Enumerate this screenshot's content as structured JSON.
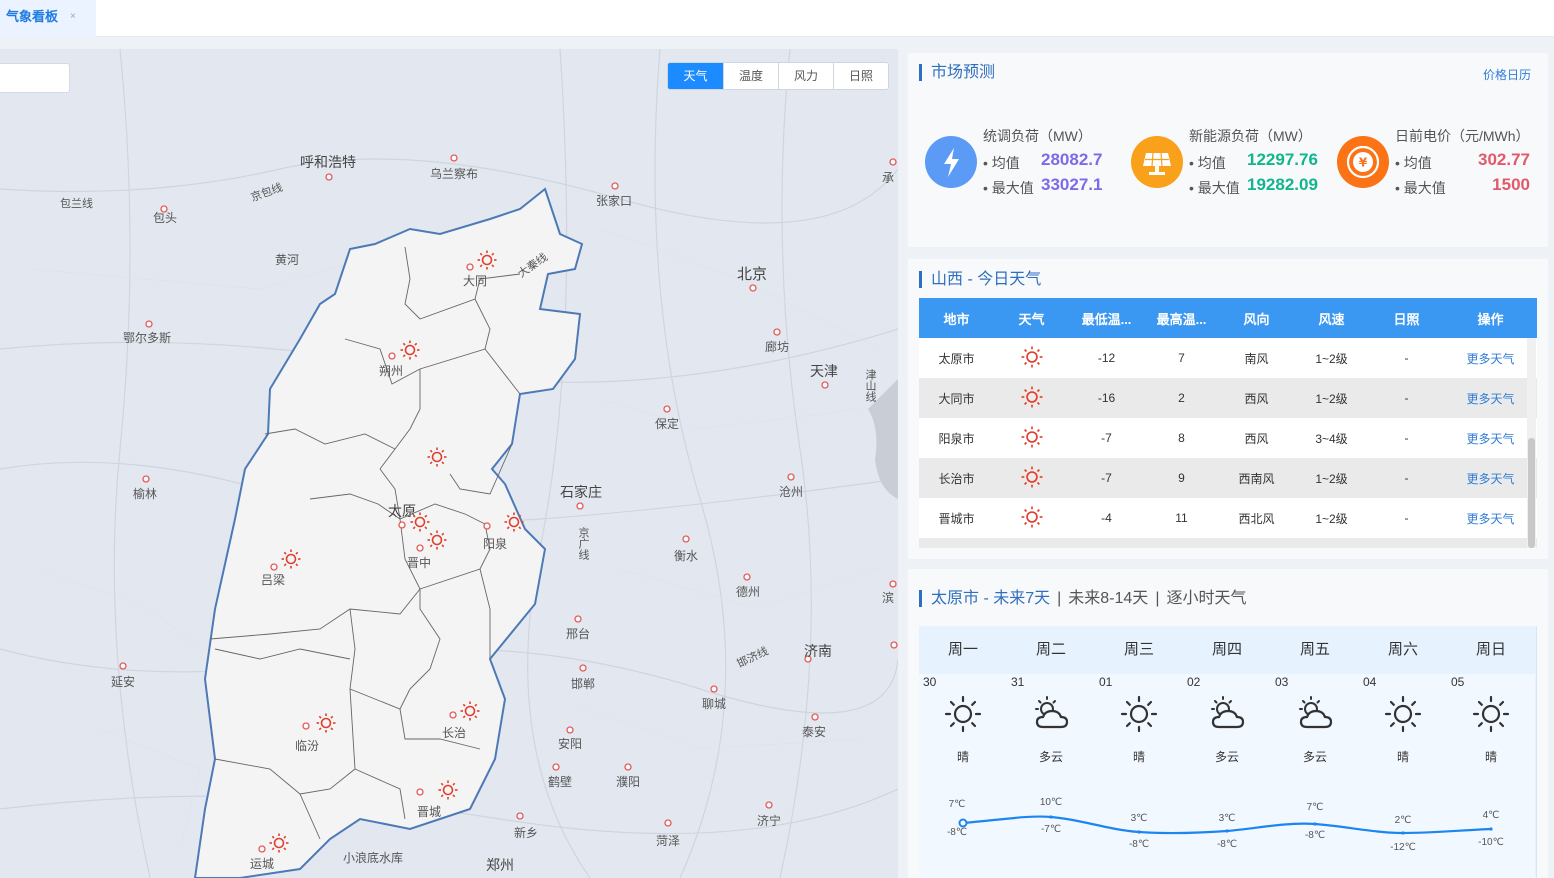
{
  "tabbar": {
    "tab_label": "气象看板",
    "tab_close": "×"
  },
  "map": {
    "modes": [
      "天气",
      "温度",
      "风力",
      "日照"
    ],
    "active_mode": "天气",
    "cities": [
      "呼和浩特",
      "乌兰察布",
      "张家口",
      "包头",
      "包兰线",
      "京包线",
      "黄河",
      "大同",
      "大秦线",
      "北京",
      "承",
      "鄂尔多斯",
      "朔州",
      "廊坊",
      "天津",
      "津山线",
      "保定",
      "榆林",
      "太原",
      "阳泉",
      "石家庄",
      "京广线",
      "沧州",
      "吕梁",
      "晋中",
      "衡水",
      "德州",
      "滨",
      "邢台",
      "济南",
      "延安",
      "邯郸",
      "邯济线",
      "聊城",
      "泰安",
      "临汾",
      "长治",
      "安阳",
      "鹤壁",
      "濮阳",
      "晋城",
      "新乡",
      "济宁",
      "菏泽",
      "运城",
      "小浪底水库",
      "郑州"
    ]
  },
  "market": {
    "title": "市场预测",
    "link": "价格日历",
    "metrics": [
      {
        "name": "统调负荷（MW）",
        "avg_label": "• 均值",
        "avg": "28082.7",
        "max_label": "• 最大值",
        "max": "33027.1",
        "color": "#7b6be8",
        "icon": "lightning-icon"
      },
      {
        "name": "新能源负荷（MW）",
        "avg_label": "• 均值",
        "avg": "12297.76",
        "max_label": "• 最大值",
        "max": "19282.09",
        "color": "#12b58f",
        "icon": "solar-panel-icon"
      },
      {
        "name": "日前电价（元/MWh）",
        "avg_label": "• 均值",
        "avg": "302.77",
        "max_label": "• 最大值",
        "max": "1500",
        "color": "#e05a6a",
        "icon": "yuan-icon"
      }
    ]
  },
  "today": {
    "title": "山西 - 今日天气",
    "columns": [
      "地市",
      "天气",
      "最低温...",
      "最高温...",
      "风向",
      "风速",
      "日照",
      "操作"
    ],
    "rows": [
      {
        "city": "太原市",
        "low": "-12",
        "high": "7",
        "wind_dir": "南风",
        "wind_speed": "1~2级",
        "sun": "-",
        "action": "更多天气"
      },
      {
        "city": "大同市",
        "low": "-16",
        "high": "2",
        "wind_dir": "西风",
        "wind_speed": "1~2级",
        "sun": "-",
        "action": "更多天气"
      },
      {
        "city": "阳泉市",
        "low": "-7",
        "high": "8",
        "wind_dir": "西风",
        "wind_speed": "3~4级",
        "sun": "-",
        "action": "更多天气"
      },
      {
        "city": "长治市",
        "low": "-7",
        "high": "9",
        "wind_dir": "西南风",
        "wind_speed": "1~2级",
        "sun": "-",
        "action": "更多天气"
      },
      {
        "city": "晋城市",
        "low": "-4",
        "high": "11",
        "wind_dir": "西北风",
        "wind_speed": "1~2级",
        "sun": "-",
        "action": "更多天气"
      }
    ]
  },
  "forecast": {
    "title_active": "太原市 - 未来7天",
    "title_tab2": "未来8-14天",
    "title_tab3": "逐小时天气",
    "separator": "|",
    "days": [
      {
        "weekday": "周一",
        "date": "30",
        "weather": "晴",
        "icon": "sun-icon",
        "high": "7℃",
        "low": "-8℃"
      },
      {
        "weekday": "周二",
        "date": "31",
        "weather": "多云",
        "icon": "cloudy-icon",
        "high": "10℃",
        "low": "-7℃"
      },
      {
        "weekday": "周三",
        "date": "01",
        "weather": "晴",
        "icon": "sun-icon",
        "high": "3℃",
        "low": "-8℃"
      },
      {
        "weekday": "周四",
        "date": "02",
        "weather": "多云",
        "icon": "cloudy-icon",
        "high": "3℃",
        "low": "-8℃"
      },
      {
        "weekday": "周五",
        "date": "03",
        "weather": "多云",
        "icon": "cloudy-icon",
        "high": "7℃",
        "low": "-8℃"
      },
      {
        "weekday": "周六",
        "date": "04",
        "weather": "晴",
        "icon": "sun-icon",
        "high": "2℃",
        "low": "-12℃"
      },
      {
        "weekday": "周日",
        "date": "05",
        "weather": "晴",
        "icon": "sun-icon",
        "high": "4℃",
        "low": "-10℃"
      }
    ]
  }
}
